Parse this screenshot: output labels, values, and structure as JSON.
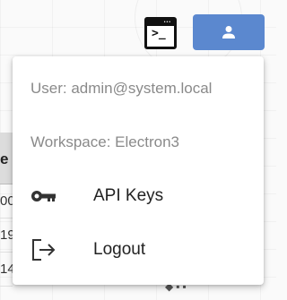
{
  "background": {
    "table_header": "e",
    "table_cells": [
      "00",
      "19",
      "14"
    ]
  },
  "toolbar": {
    "terminal_icon": "terminal-icon",
    "account_icon": "person-icon",
    "account_button_color": "#5b88cf"
  },
  "menu": {
    "user_text": "User: admin@system.local",
    "workspace_text": "Workspace: Electron3",
    "items": [
      {
        "label": "API Keys",
        "icon": "key-icon"
      },
      {
        "label": "Logout",
        "icon": "logout-icon"
      }
    ]
  }
}
